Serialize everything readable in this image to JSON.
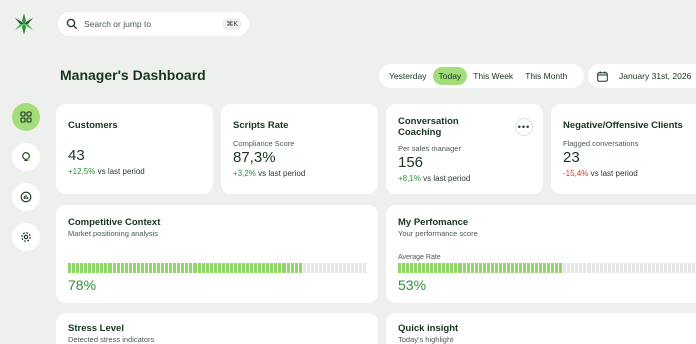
{
  "search": {
    "placeholder": "Search or jump to",
    "shortcut": "⌘K"
  },
  "sidebar": {
    "items": [
      {
        "name": "dashboard",
        "icon": "grid-icon"
      },
      {
        "name": "insights",
        "icon": "bulb-icon"
      },
      {
        "name": "reports",
        "icon": "chart-icon"
      },
      {
        "name": "settings",
        "icon": "gear-icon"
      }
    ]
  },
  "header": {
    "title": "Manager's Dashboard"
  },
  "range": {
    "options": [
      "Yesterday",
      "Today",
      "This Week",
      "This Month"
    ],
    "selected": "Today"
  },
  "date": {
    "value": "January 31st, 2026"
  },
  "cards": {
    "customers": {
      "title": "Customers",
      "value": "43",
      "delta": "+12,5%",
      "delta_suffix": "vs last period"
    },
    "scripts": {
      "title": "Scripts Rate",
      "label": "Compliance Score",
      "value": "87,3%",
      "delta": "+3,2%",
      "delta_suffix": "vs last period"
    },
    "coaching": {
      "title": "Conversation Coaching",
      "label": "Per sales manager",
      "value": "156",
      "delta": "+8,1%",
      "delta_suffix": "vs last period",
      "menu": "•••"
    },
    "negative": {
      "title": "Negative/Offensive Clients",
      "label": "Flagged conversations",
      "value": "23",
      "delta": "-15,4%",
      "delta_suffix": "vs last period"
    },
    "competitive": {
      "title": "Competitive Context",
      "subtitle": "Market positioning analysis",
      "percent": "78%",
      "level": 0.78
    },
    "performance": {
      "title": "My Perfomance",
      "subtitle": "Your performance score",
      "label": "Average Rate",
      "percent": "53%",
      "level": 0.53
    },
    "stress": {
      "title": "Stress Level",
      "subtitle": "Detected stress indicators"
    },
    "insight": {
      "title": "Quick insight",
      "subtitle": "Today's highlight"
    }
  },
  "colors": {
    "accent": "#a3de7a",
    "bar": "#8ed766",
    "positive": "#2f8f3c",
    "negative": "#d23a3a",
    "background": "#eef0ed"
  }
}
